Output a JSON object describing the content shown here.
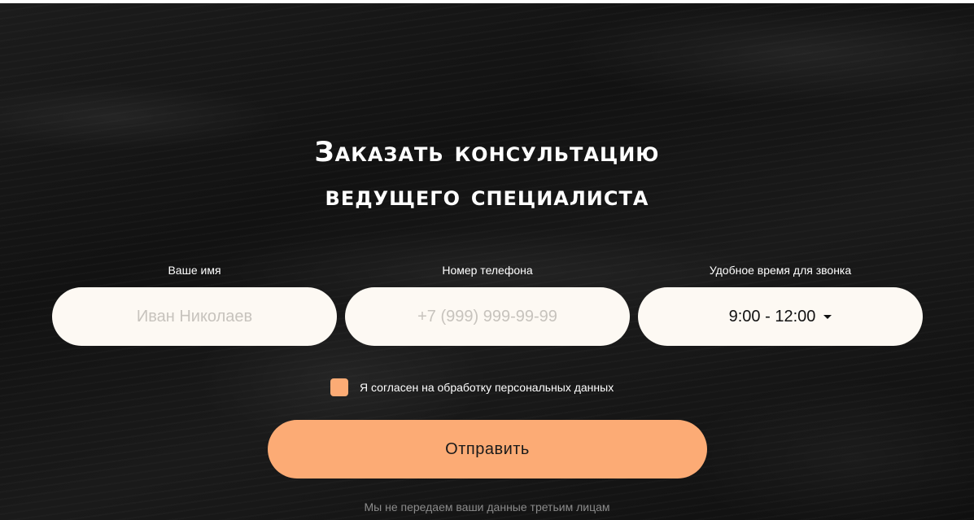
{
  "form": {
    "title_line1": "Заказать консультацию",
    "title_line2": "ведущего специалиста",
    "name_label": "Ваше имя",
    "name_placeholder": "Иван Николаев",
    "phone_label": "Номер телефона",
    "phone_placeholder": "+7 (999) 999-99-99",
    "time_label": "Удобное время для звонка",
    "time_value": "9:00 - 12:00",
    "consent_label": "Я согласен на обработку персональных данных",
    "submit_label": "Отправить",
    "footnote": "Мы не передаем ваши данные третьим лицам"
  },
  "colors": {
    "accent": "#fcab75",
    "field_bg": "#fdf9f3",
    "background": "#141414"
  },
  "icons": {
    "select_caret": "caret-down-icon"
  }
}
